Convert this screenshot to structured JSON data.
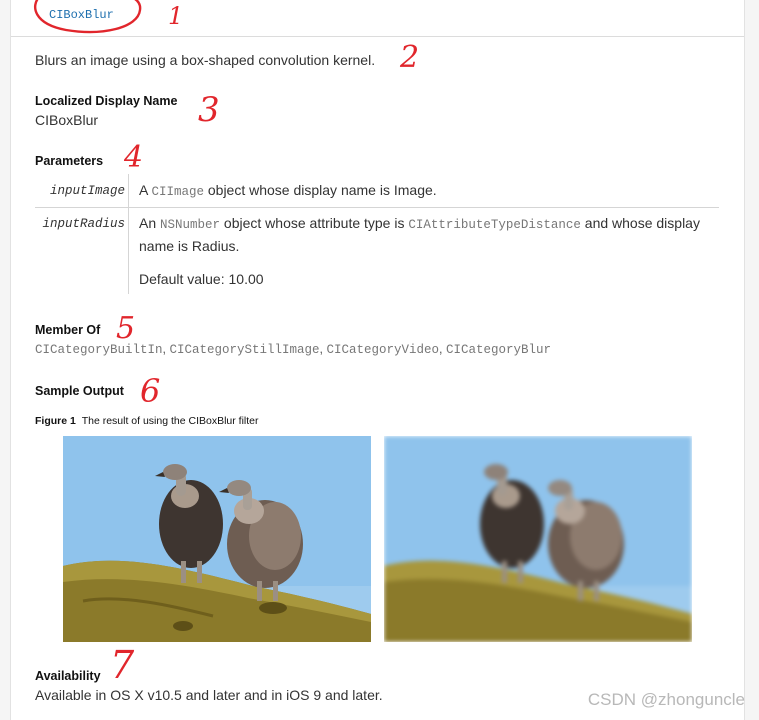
{
  "doc": {
    "filter_name": "CIBoxBlur",
    "summary": "Blurs an image using a box-shaped convolution kernel.",
    "localized_display_name": {
      "heading": "Localized Display Name",
      "value": "CIBoxBlur"
    },
    "parameters": {
      "heading": "Parameters",
      "rows": [
        {
          "name": "inputImage",
          "desc_prefix": "A ",
          "desc_code": "CIImage",
          "desc_suffix": " object whose display name is Image."
        },
        {
          "name": "inputRadius",
          "desc_prefix": "An ",
          "desc_code": "NSNumber",
          "desc_mid": " object whose attribute type is ",
          "desc_code2": "CIAttributeTypeDistance",
          "desc_suffix": " and whose display",
          "desc_line2": "name is Radius.",
          "default": "Default value: 10.00"
        }
      ]
    },
    "member_of": {
      "heading": "Member Of",
      "categories": [
        "CICategoryBuiltIn",
        "CICategoryStillImage",
        "CICategoryVideo",
        "CICategoryBlur"
      ],
      "separator": ", "
    },
    "sample_output": {
      "heading": "Sample Output",
      "figure_label": "Figure 1",
      "figure_caption": "The result of using the CIBoxBlur filter"
    },
    "availability": {
      "heading": "Availability",
      "text": "Available in OS X v10.5 and later and in iOS 9 and later."
    }
  },
  "annotations": [
    "1",
    "2",
    "3",
    "4",
    "5",
    "6",
    "7"
  ],
  "watermark": "CSDN @zhonguncle",
  "colors": {
    "link": "#1e6fae",
    "annotation_red": "#e1262c",
    "code_grey": "#777777",
    "sky": "#8fc3ec",
    "branch": "#8b7a2a"
  }
}
